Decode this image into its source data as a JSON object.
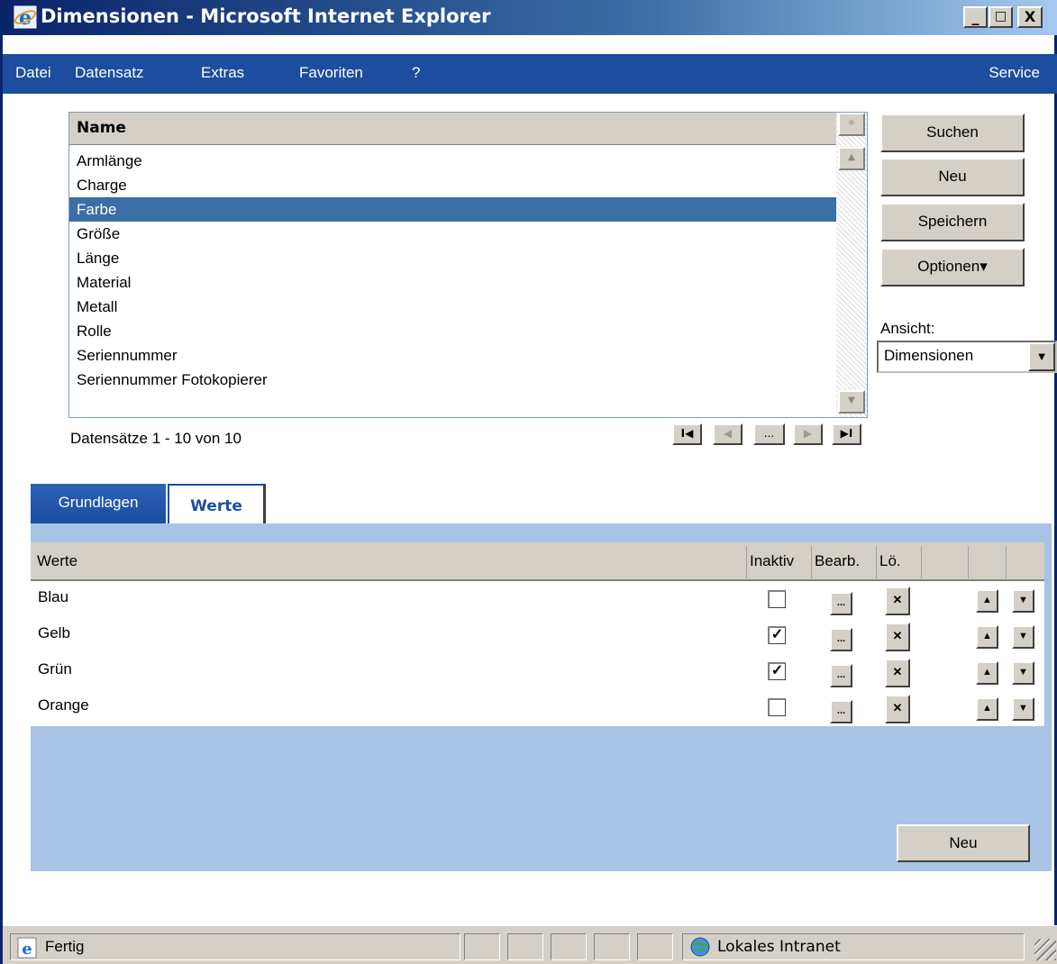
{
  "window": {
    "title": "Dimensionen - Microsoft Internet Explorer",
    "buttons": {
      "minimize": "_",
      "maximize": "□",
      "close": "X"
    }
  },
  "menu": {
    "items": [
      "Datei",
      "Datensatz",
      "Extras",
      "Favoriten",
      "?"
    ],
    "service": "Service"
  },
  "list": {
    "header": "Name",
    "items": [
      "Armlänge",
      "Charge",
      "Farbe",
      "Größe",
      "Länge",
      "Material",
      "Metall",
      "Rolle",
      "Seriennummer",
      "Seriennummer Fotokopierer"
    ],
    "selected": "Farbe",
    "record_text": "Datensätze 1 - 10 von 10",
    "pager": {
      "first": "I◀",
      "prev": "◀",
      "dots": "...",
      "next": "▶",
      "last": "▶I"
    }
  },
  "actions": {
    "search": "Suchen",
    "new": "Neu",
    "save": "Speichern",
    "options": "Optionen▾"
  },
  "view": {
    "label": "Ansicht:",
    "selected": "Dimensionen"
  },
  "tabs": [
    {
      "label": "Grundlagen",
      "active": false
    },
    {
      "label": "Werte",
      "active": true
    }
  ],
  "values_grid": {
    "headers": {
      "name": "Werte",
      "inactive": "Inaktiv",
      "edit": "Bearb.",
      "delete": "Lö."
    },
    "rows": [
      {
        "name": "Blau",
        "inactive": false
      },
      {
        "name": "Gelb",
        "inactive": true
      },
      {
        "name": "Grün",
        "inactive": true
      },
      {
        "name": "Orange",
        "inactive": false
      }
    ],
    "edit_glyph": "...",
    "delete_glyph": "✕",
    "up_glyph": "▲",
    "down_glyph": "▼",
    "new_button": "Neu"
  },
  "status": {
    "text": "Fertig",
    "zone": "Lokales Intranet"
  },
  "colors": {
    "title_dark": "#0a246a",
    "menu_blue": "#1c4d9e",
    "selection": "#3a6ea5",
    "panel_bg": "#a8c3e5",
    "button_face": "#d4d0c8"
  }
}
